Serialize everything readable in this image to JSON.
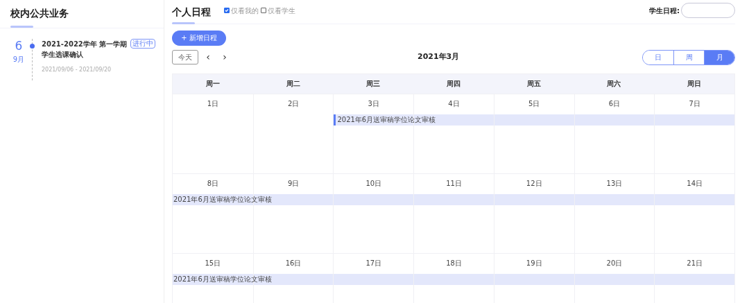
{
  "left": {
    "title": "校内公共业务",
    "items": [
      {
        "day": "6",
        "month": "9月",
        "title": "2021-2022学年 第一学期学生选课确认",
        "badge": "进行中",
        "dates": "2021/09/06 - 2021/09/20"
      }
    ]
  },
  "right": {
    "title": "个人日程",
    "filters": [
      {
        "label": "仅看我的",
        "checked": true
      },
      {
        "label": "仅看学生",
        "checked": false
      }
    ],
    "student_label": "学生日程:",
    "add_button": "+ 新增日程",
    "today_button": "今天",
    "prev": "‹",
    "next": "›",
    "month_title": "2021年3月",
    "views": [
      {
        "label": "日",
        "selected": false
      },
      {
        "label": "周",
        "selected": false
      },
      {
        "label": "月",
        "selected": true
      }
    ],
    "weekdays": [
      "周一",
      "周二",
      "周三",
      "周四",
      "周五",
      "周六",
      "周日"
    ],
    "weeks": [
      {
        "days": [
          {
            "label": "1日",
            "in_event": false
          },
          {
            "label": "2日",
            "in_event": false
          },
          {
            "label": "3日",
            "in_event": true
          },
          {
            "label": "4日",
            "in_event": true
          },
          {
            "label": "5日",
            "in_event": true
          },
          {
            "label": "6日",
            "in_event": true
          },
          {
            "label": "7日",
            "in_event": true
          }
        ],
        "event": {
          "title": "2021年6月送审稿学位论文审核",
          "continued": false
        }
      },
      {
        "days": [
          {
            "label": "8日",
            "in_event": true
          },
          {
            "label": "9日",
            "in_event": true
          },
          {
            "label": "10日",
            "in_event": true
          },
          {
            "label": "11日",
            "in_event": true
          },
          {
            "label": "12日",
            "in_event": true
          },
          {
            "label": "13日",
            "in_event": true
          },
          {
            "label": "14日",
            "in_event": true
          }
        ],
        "event": {
          "title": "2021年6月送审稿学位论文审核",
          "continued": true
        }
      },
      {
        "days": [
          {
            "label": "15日",
            "in_event": true
          },
          {
            "label": "16日",
            "in_event": true
          },
          {
            "label": "17日",
            "in_event": true
          },
          {
            "label": "18日",
            "in_event": true
          },
          {
            "label": "19日",
            "in_event": true
          },
          {
            "label": "20日",
            "in_event": true
          },
          {
            "label": "21日",
            "in_event": true
          }
        ],
        "event": {
          "title": "2021年6月送审稿学位论文审核",
          "continued": true
        }
      }
    ]
  }
}
